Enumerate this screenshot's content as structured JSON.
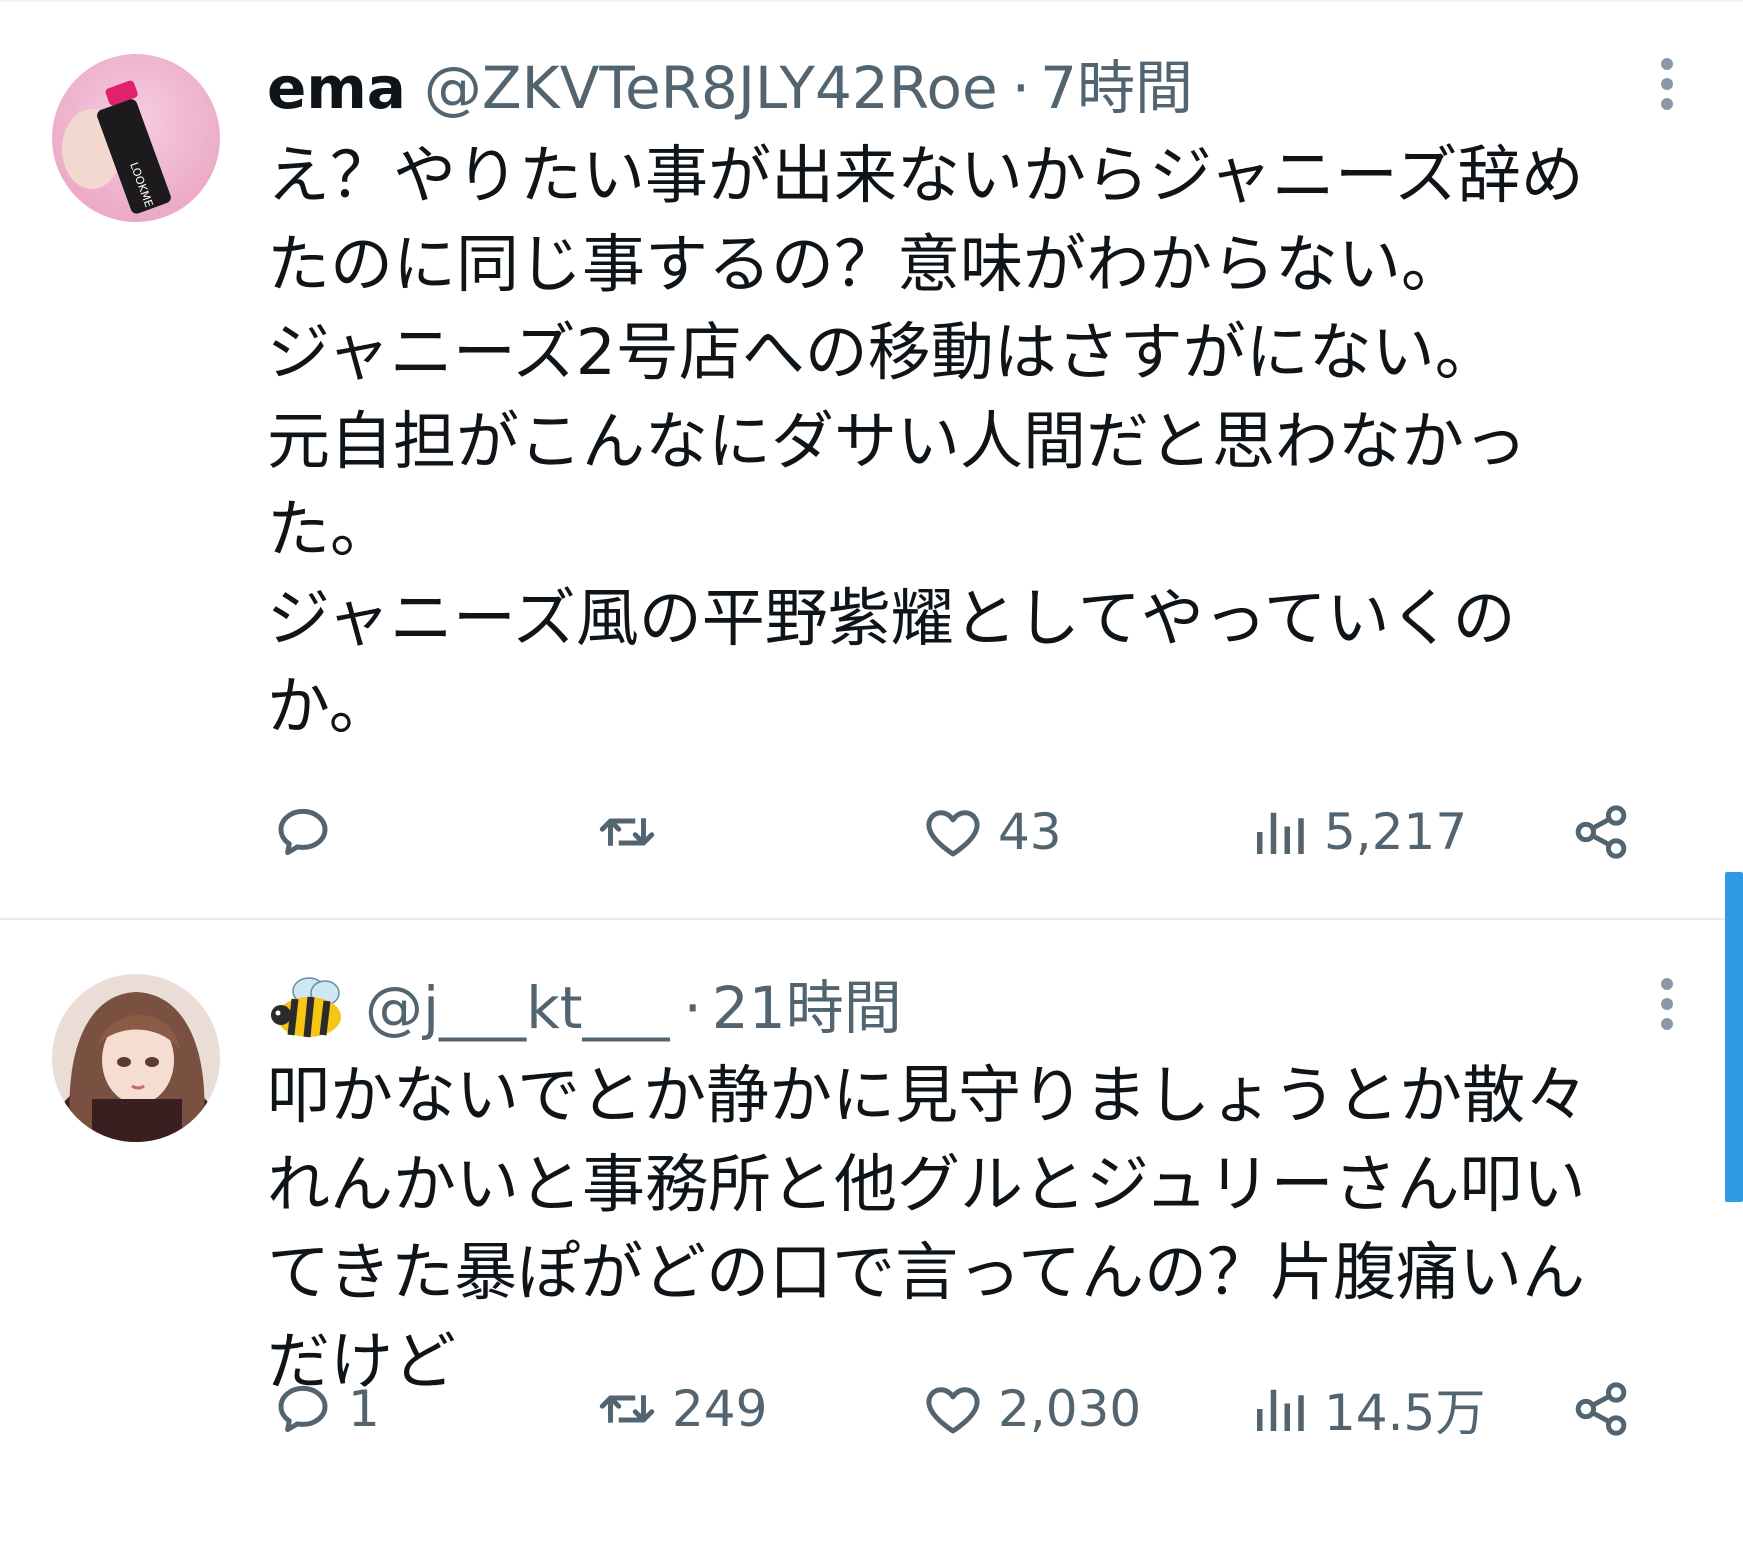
{
  "tweets": [
    {
      "name": "ema",
      "handle": "@ZKVTeR8JLY42Roe",
      "separator": "·",
      "time": "7時間",
      "text_lines": [
        "え？やりたい事が出来ないからジャニーズ辞め",
        "たのに同じ事するの？意味がわからない。",
        "ジャニーズ2号店への移動はさすがにない。",
        "元自担がこんなにダサい人間だと思わなかっ",
        "た。",
        "ジャニーズ風の平野紫耀としてやっていくの",
        "か。"
      ],
      "actions": {
        "reply_count": "",
        "retweet_count": "",
        "like_count": "43",
        "view_count": "5,217"
      },
      "avatar_icon": "lipstick-avatar-image"
    },
    {
      "name_emoji": "bee-emoji",
      "handle": "@j___kt___",
      "separator": "·",
      "time": "21時間",
      "text_lines": [
        "叩かないでとか静かに見守りましょうとか散々",
        "れんかいと事務所と他グルとジュリーさん叩い",
        "てきた暴ぽがどの口で言ってんの？片腹痛いん",
        "だけど"
      ],
      "actions": {
        "reply_count": "1",
        "retweet_count": "249",
        "like_count": "2,030",
        "view_count": "14.5万"
      },
      "avatar_icon": "anime-girl-avatar-image"
    }
  ],
  "colors": {
    "text_primary": "#0f1419",
    "text_secondary": "#536471",
    "divider": "#e7eaec",
    "scrollbar": "#2f9be6"
  },
  "icons": {
    "reply": "reply-icon",
    "retweet": "retweet-icon",
    "like": "heart-icon",
    "views": "views-icon",
    "share": "share-icon",
    "more": "more-vertical-icon"
  }
}
